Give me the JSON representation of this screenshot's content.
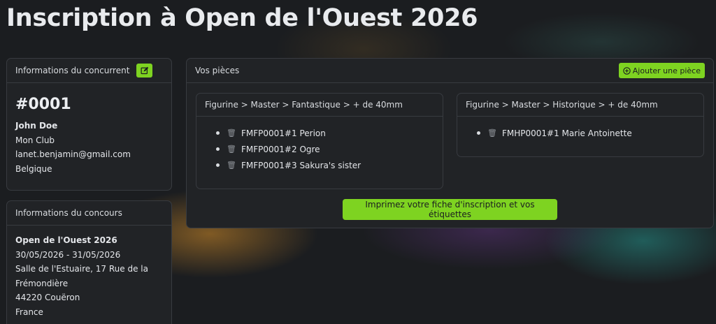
{
  "page": {
    "title": "Inscription à Open de l'Ouest 2026"
  },
  "competitor": {
    "header": "Informations du concurrent",
    "edit_icon": "edit-icon",
    "number": "#0001",
    "name": "John Doe",
    "club": "Mon Club",
    "email": "lanet.benjamin@gmail.com",
    "country": "Belgique"
  },
  "contest": {
    "header": "Informations du concours",
    "name": "Open de l'Ouest 2026",
    "dates": "30/05/2026 - 31/05/2026",
    "address_line1": "Salle de l'Estuaire, 17 Rue de la",
    "address_line2": "Frémondière",
    "postal": "44220 Couëron",
    "country": "France"
  },
  "pieces": {
    "header": "Vos pièces",
    "add_label": "Ajouter une pièce",
    "add_icon": "plus-circle-icon",
    "categories": [
      {
        "title": "Figurine > Master > Fantastique > + de 40mm",
        "items": [
          "FMFP0001#1 Perion",
          "FMFP0001#2 Ogre",
          "FMFP0001#3 Sakura's sister"
        ]
      },
      {
        "title": "Figurine > Master > Historique > + de 40mm",
        "items": [
          "FMHP0001#1 Marie Antoinette"
        ]
      }
    ],
    "print_label": "Imprimez votre fiche d'inscription et vos étiquettes"
  },
  "colors": {
    "accent": "#7ed321",
    "background": "#1b1d20",
    "card": "#212326",
    "border": "#383b40"
  }
}
